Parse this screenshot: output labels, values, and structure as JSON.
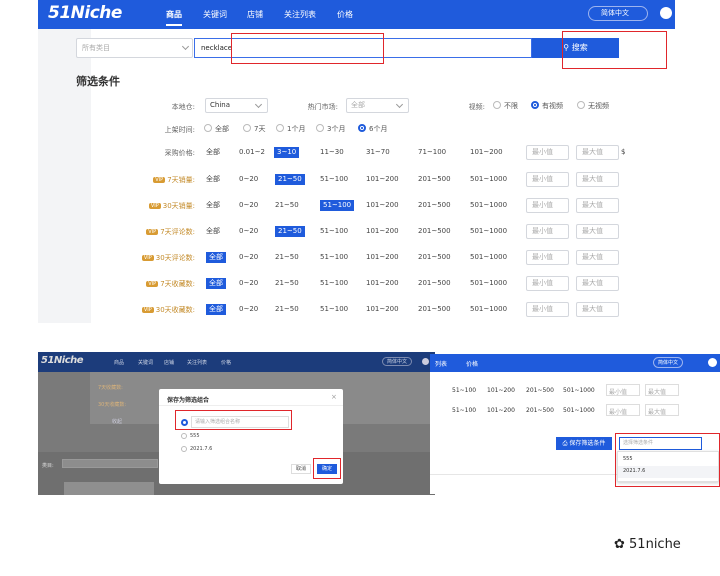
{
  "top": {
    "logo": "51Niche",
    "nav": [
      "商品",
      "关键词",
      "店铺",
      "关注列表",
      "价格"
    ],
    "lang": "简体中文",
    "category_placeholder": "所有类目",
    "search_value": "necklace",
    "search_btn": "搜索",
    "filter_title": "筛选条件",
    "labels": {
      "origin": "本地仓:",
      "market": "热门市场:",
      "video": "视频:",
      "time": "上架时间:",
      "price": "采购价格:"
    },
    "origin_value": "China",
    "market_value": "全部",
    "video_opts": [
      "不限",
      "有视频",
      "无视频"
    ],
    "time_opts": [
      "全部",
      "7天",
      "1个月",
      "3个月",
      "6个月"
    ],
    "price_opts": [
      "全部",
      "0.01~2",
      "3~10",
      "11~30",
      "31~70",
      "71~100",
      "101~200"
    ],
    "price_unit": "$",
    "min": "最小值",
    "max": "最大值",
    "rows": [
      {
        "label": "7天销量:",
        "opts": [
          "全部",
          "0~20",
          "21~50",
          "51~100",
          "101~200",
          "201~500",
          "501~1000"
        ]
      },
      {
        "label": "30天销量:",
        "opts": [
          "全部",
          "0~20",
          "21~50",
          "51~100",
          "101~200",
          "201~500",
          "501~1000"
        ]
      },
      {
        "label": "7天评论数:",
        "opts": [
          "全部",
          "0~20",
          "21~50",
          "51~100",
          "101~200",
          "201~500",
          "501~1000"
        ]
      },
      {
        "label": "30天评论数:",
        "opts": [
          "全部",
          "0~20",
          "21~50",
          "51~100",
          "101~200",
          "201~500",
          "501~1000"
        ]
      },
      {
        "label": "7天收藏数:",
        "opts": [
          "全部",
          "0~20",
          "21~50",
          "51~100",
          "101~200",
          "201~500",
          "501~1000"
        ]
      },
      {
        "label": "30天收藏数:",
        "opts": [
          "全部",
          "0~20",
          "21~50",
          "51~100",
          "101~200",
          "201~500",
          "501~1000"
        ]
      }
    ],
    "vip": "VIP"
  },
  "bl": {
    "logo": "51Niche",
    "nav": [
      "商品",
      "关键词",
      "店铺",
      "关注列表",
      "价格"
    ],
    "lang": "简体中文",
    "rows": [
      "7天收藏数:",
      "30天收藏数:"
    ],
    "dialog": {
      "title": "保存为筛选组合",
      "placeholder": "请输入筛选组合名称",
      "opt1": "555",
      "opt2": "2021.7.6",
      "cancel": "取消",
      "ok": "确定"
    },
    "side_label": "类目:",
    "link": "收起"
  },
  "br": {
    "nav": [
      "列表",
      "价格"
    ],
    "lang": "简体中文",
    "opts": [
      "51~100",
      "101~200",
      "201~500",
      "501~1000"
    ],
    "min": "最小值",
    "max": "最大值",
    "save_btn": "保存筛选条件",
    "select_placeholder": "选择筛选条件",
    "dd": [
      "555",
      "2021.7.6"
    ]
  },
  "watermark": "51niche"
}
